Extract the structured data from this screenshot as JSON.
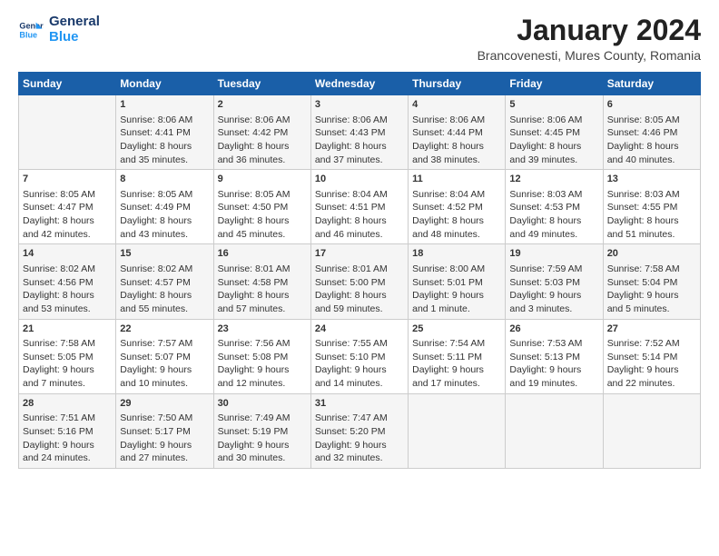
{
  "header": {
    "logo_line1": "General",
    "logo_line2": "Blue",
    "month_title": "January 2024",
    "subtitle": "Brancovenesti, Mures County, Romania"
  },
  "days_of_week": [
    "Sunday",
    "Monday",
    "Tuesday",
    "Wednesday",
    "Thursday",
    "Friday",
    "Saturday"
  ],
  "weeks": [
    [
      {
        "day": "",
        "content": ""
      },
      {
        "day": "1",
        "content": "Sunrise: 8:06 AM\nSunset: 4:41 PM\nDaylight: 8 hours\nand 35 minutes."
      },
      {
        "day": "2",
        "content": "Sunrise: 8:06 AM\nSunset: 4:42 PM\nDaylight: 8 hours\nand 36 minutes."
      },
      {
        "day": "3",
        "content": "Sunrise: 8:06 AM\nSunset: 4:43 PM\nDaylight: 8 hours\nand 37 minutes."
      },
      {
        "day": "4",
        "content": "Sunrise: 8:06 AM\nSunset: 4:44 PM\nDaylight: 8 hours\nand 38 minutes."
      },
      {
        "day": "5",
        "content": "Sunrise: 8:06 AM\nSunset: 4:45 PM\nDaylight: 8 hours\nand 39 minutes."
      },
      {
        "day": "6",
        "content": "Sunrise: 8:05 AM\nSunset: 4:46 PM\nDaylight: 8 hours\nand 40 minutes."
      }
    ],
    [
      {
        "day": "7",
        "content": "Sunrise: 8:05 AM\nSunset: 4:47 PM\nDaylight: 8 hours\nand 42 minutes."
      },
      {
        "day": "8",
        "content": "Sunrise: 8:05 AM\nSunset: 4:49 PM\nDaylight: 8 hours\nand 43 minutes."
      },
      {
        "day": "9",
        "content": "Sunrise: 8:05 AM\nSunset: 4:50 PM\nDaylight: 8 hours\nand 45 minutes."
      },
      {
        "day": "10",
        "content": "Sunrise: 8:04 AM\nSunset: 4:51 PM\nDaylight: 8 hours\nand 46 minutes."
      },
      {
        "day": "11",
        "content": "Sunrise: 8:04 AM\nSunset: 4:52 PM\nDaylight: 8 hours\nand 48 minutes."
      },
      {
        "day": "12",
        "content": "Sunrise: 8:03 AM\nSunset: 4:53 PM\nDaylight: 8 hours\nand 49 minutes."
      },
      {
        "day": "13",
        "content": "Sunrise: 8:03 AM\nSunset: 4:55 PM\nDaylight: 8 hours\nand 51 minutes."
      }
    ],
    [
      {
        "day": "14",
        "content": "Sunrise: 8:02 AM\nSunset: 4:56 PM\nDaylight: 8 hours\nand 53 minutes."
      },
      {
        "day": "15",
        "content": "Sunrise: 8:02 AM\nSunset: 4:57 PM\nDaylight: 8 hours\nand 55 minutes."
      },
      {
        "day": "16",
        "content": "Sunrise: 8:01 AM\nSunset: 4:58 PM\nDaylight: 8 hours\nand 57 minutes."
      },
      {
        "day": "17",
        "content": "Sunrise: 8:01 AM\nSunset: 5:00 PM\nDaylight: 8 hours\nand 59 minutes."
      },
      {
        "day": "18",
        "content": "Sunrise: 8:00 AM\nSunset: 5:01 PM\nDaylight: 9 hours\nand 1 minute."
      },
      {
        "day": "19",
        "content": "Sunrise: 7:59 AM\nSunset: 5:03 PM\nDaylight: 9 hours\nand 3 minutes."
      },
      {
        "day": "20",
        "content": "Sunrise: 7:58 AM\nSunset: 5:04 PM\nDaylight: 9 hours\nand 5 minutes."
      }
    ],
    [
      {
        "day": "21",
        "content": "Sunrise: 7:58 AM\nSunset: 5:05 PM\nDaylight: 9 hours\nand 7 minutes."
      },
      {
        "day": "22",
        "content": "Sunrise: 7:57 AM\nSunset: 5:07 PM\nDaylight: 9 hours\nand 10 minutes."
      },
      {
        "day": "23",
        "content": "Sunrise: 7:56 AM\nSunset: 5:08 PM\nDaylight: 9 hours\nand 12 minutes."
      },
      {
        "day": "24",
        "content": "Sunrise: 7:55 AM\nSunset: 5:10 PM\nDaylight: 9 hours\nand 14 minutes."
      },
      {
        "day": "25",
        "content": "Sunrise: 7:54 AM\nSunset: 5:11 PM\nDaylight: 9 hours\nand 17 minutes."
      },
      {
        "day": "26",
        "content": "Sunrise: 7:53 AM\nSunset: 5:13 PM\nDaylight: 9 hours\nand 19 minutes."
      },
      {
        "day": "27",
        "content": "Sunrise: 7:52 AM\nSunset: 5:14 PM\nDaylight: 9 hours\nand 22 minutes."
      }
    ],
    [
      {
        "day": "28",
        "content": "Sunrise: 7:51 AM\nSunset: 5:16 PM\nDaylight: 9 hours\nand 24 minutes."
      },
      {
        "day": "29",
        "content": "Sunrise: 7:50 AM\nSunset: 5:17 PM\nDaylight: 9 hours\nand 27 minutes."
      },
      {
        "day": "30",
        "content": "Sunrise: 7:49 AM\nSunset: 5:19 PM\nDaylight: 9 hours\nand 30 minutes."
      },
      {
        "day": "31",
        "content": "Sunrise: 7:47 AM\nSunset: 5:20 PM\nDaylight: 9 hours\nand 32 minutes."
      },
      {
        "day": "",
        "content": ""
      },
      {
        "day": "",
        "content": ""
      },
      {
        "day": "",
        "content": ""
      }
    ]
  ]
}
